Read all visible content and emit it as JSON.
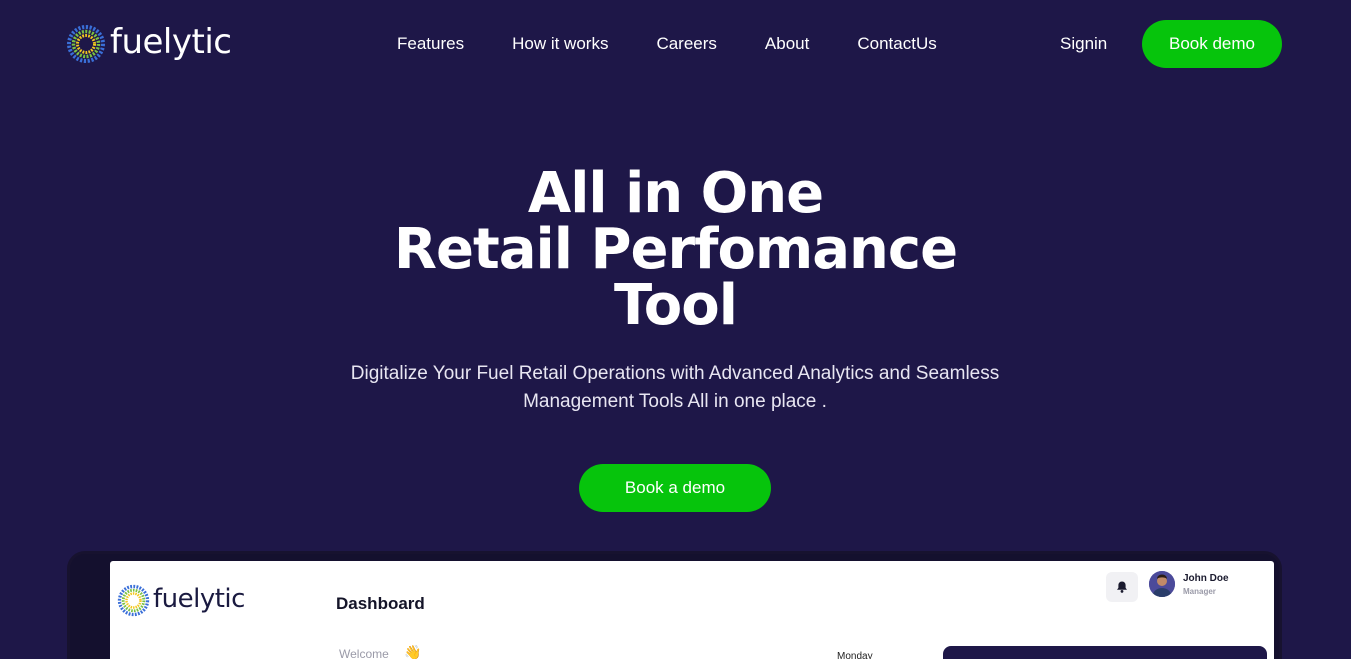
{
  "brand": {
    "name": "fuelytic",
    "colors": {
      "background": "#1e1748",
      "accent": "#06c40c",
      "text": "#ffffff"
    }
  },
  "nav": {
    "items": [
      {
        "label": "Features"
      },
      {
        "label": "How it works"
      },
      {
        "label": "Careers"
      },
      {
        "label": "About"
      },
      {
        "label": "ContactUs"
      }
    ],
    "signin_label": "Signin",
    "book_demo_label": "Book demo"
  },
  "hero": {
    "title_lines": [
      "All in One",
      "Retail Perfomance",
      "Tool"
    ],
    "subtitle": "Digitalize Your Fuel Retail Operations with Advanced Analytics and Seamless Management Tools All in one place .",
    "cta_label": "Book a demo"
  },
  "preview": {
    "logo_text": "fuelytic",
    "page_title": "Dashboard",
    "welcome_text": "Welcome",
    "welcome_emoji": "👋",
    "day_label": "Monday",
    "user": {
      "name": "John Doe",
      "role": "Manager"
    },
    "icons": [
      "bell-icon",
      "avatar"
    ]
  }
}
